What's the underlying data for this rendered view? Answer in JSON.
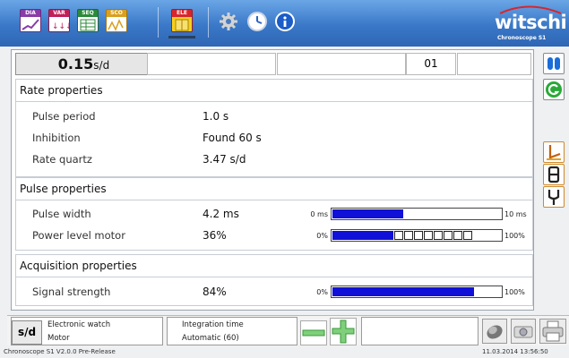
{
  "toolbar": {
    "buttons": [
      {
        "label": "DIA",
        "color": "#8a3ba8"
      },
      {
        "label": "VAR",
        "color": "#c0205a"
      },
      {
        "label": "SEQ",
        "color": "#2c8a3a"
      },
      {
        "label": "SCO",
        "color": "#d9a020"
      },
      {
        "label": "ELE",
        "color": "#d8262c"
      }
    ],
    "icons": [
      "settings-gear-icon",
      "clock-icon",
      "info-icon"
    ],
    "logo": {
      "brand": "witschi",
      "sub": "Chronoscope S1"
    }
  },
  "top_row": {
    "rate_value": "0.15",
    "rate_unit": "s/d",
    "cell3": "01"
  },
  "rate_properties": {
    "title": "Rate properties",
    "rows": [
      {
        "label": "Pulse period",
        "value": "1.0 s"
      },
      {
        "label": "Inhibition",
        "value": "Found 60 s"
      },
      {
        "label": "Rate quartz",
        "value": "3.47 s/d"
      }
    ]
  },
  "pulse_properties": {
    "title": "Pulse properties",
    "pulse_width": {
      "label": "Pulse width",
      "value": "4.2 ms",
      "min": "0 ms",
      "max": "10 ms",
      "fill_fraction": 0.42
    },
    "power_level": {
      "label": "Power level motor",
      "value": "36%",
      "min": "0%",
      "max": "100%",
      "fill_fraction": 0.36,
      "segments": 8
    }
  },
  "acquisition_properties": {
    "title": "Acquisition properties",
    "signal": {
      "label": "Signal strength",
      "value": "84%",
      "min": "0%",
      "max": "100%",
      "fill_fraction": 0.84
    }
  },
  "status_bar": {
    "sd_label": "s/d",
    "watch_type": "Electronic watch",
    "watch_mode": "Motor",
    "integration_label": "Integration time",
    "integration_value": "Automatic (60)"
  },
  "footer": {
    "version": "Chronoscope S1 V2.0.0 Pre-Release",
    "datetime": "11.03.2014 13:56:50"
  },
  "colors": {
    "bar_fill": "#1010d8",
    "accent": "#3a78c8"
  }
}
